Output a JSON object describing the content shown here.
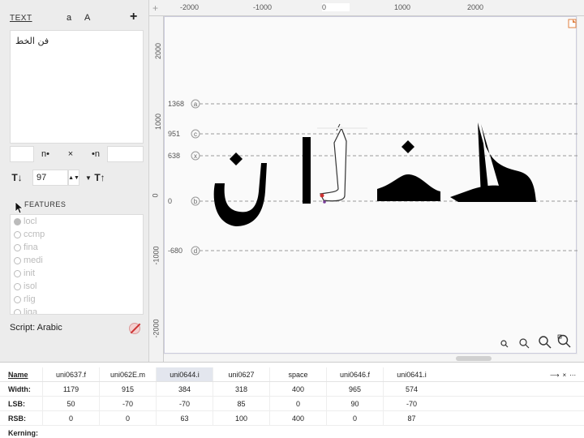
{
  "sidebar": {
    "text_title": "TEXT",
    "case_lower": "a",
    "case_upper": "A",
    "add_label": "+",
    "text_content": "فن الخط",
    "nav": {
      "prev": "n•",
      "clear": "×",
      "next": "•n"
    },
    "size": {
      "value": "97",
      "stepper": "▲▼",
      "dropdown": "▼",
      "decrease_icon": "T↓",
      "increase_icon": "T↑"
    },
    "features_label": "FEATURES",
    "features": [
      {
        "name": "locl",
        "on": true
      },
      {
        "name": "ccmp",
        "on": false
      },
      {
        "name": "fina",
        "on": false
      },
      {
        "name": "medi",
        "on": false
      },
      {
        "name": "init",
        "on": false
      },
      {
        "name": "isol",
        "on": false
      },
      {
        "name": "rlig",
        "on": false
      },
      {
        "name": "liga",
        "on": false
      }
    ],
    "script_label": "Script: Arabic"
  },
  "rulers": {
    "top": [
      "-2000",
      "-1000",
      "0",
      "1000",
      "2000"
    ],
    "left": [
      "2000",
      "1000",
      "0",
      "-1000",
      "-2000"
    ]
  },
  "guides": [
    {
      "value": "1368",
      "tag": "a"
    },
    {
      "value": "951",
      "tag": "c"
    },
    {
      "value": "638",
      "tag": "x"
    },
    {
      "value": "0",
      "tag": "b"
    },
    {
      "value": "-680",
      "tag": "d"
    }
  ],
  "metrics": {
    "labels": {
      "name": "Name",
      "width": "Width:",
      "lsb": "LSB:",
      "rsb": "RSB:",
      "kerning": "Kerning:"
    },
    "glyphs": [
      {
        "name": "uni0637.f",
        "width": "1179",
        "lsb": "50",
        "rsb": "0"
      },
      {
        "name": "uni062E.m",
        "width": "915",
        "lsb": "-70",
        "rsb": "0"
      },
      {
        "name": "uni0644.i",
        "width": "384",
        "lsb": "-70",
        "rsb": "63"
      },
      {
        "name": "uni0627",
        "width": "318",
        "lsb": "85",
        "rsb": "100"
      },
      {
        "name": "space",
        "width": "400",
        "lsb": "0",
        "rsb": "400"
      },
      {
        "name": "uni0646.f",
        "width": "965",
        "lsb": "90",
        "rsb": "0"
      },
      {
        "name": "uni0641.i",
        "width": "574",
        "lsb": "-70",
        "rsb": "87"
      }
    ],
    "selected_index": 2,
    "controls": {
      "arrow": "⟶",
      "close": "×",
      "more": "⋯"
    }
  },
  "colors": {
    "selection": "#e3e6ee",
    "guide": "#999999",
    "glyph": "#000000"
  }
}
